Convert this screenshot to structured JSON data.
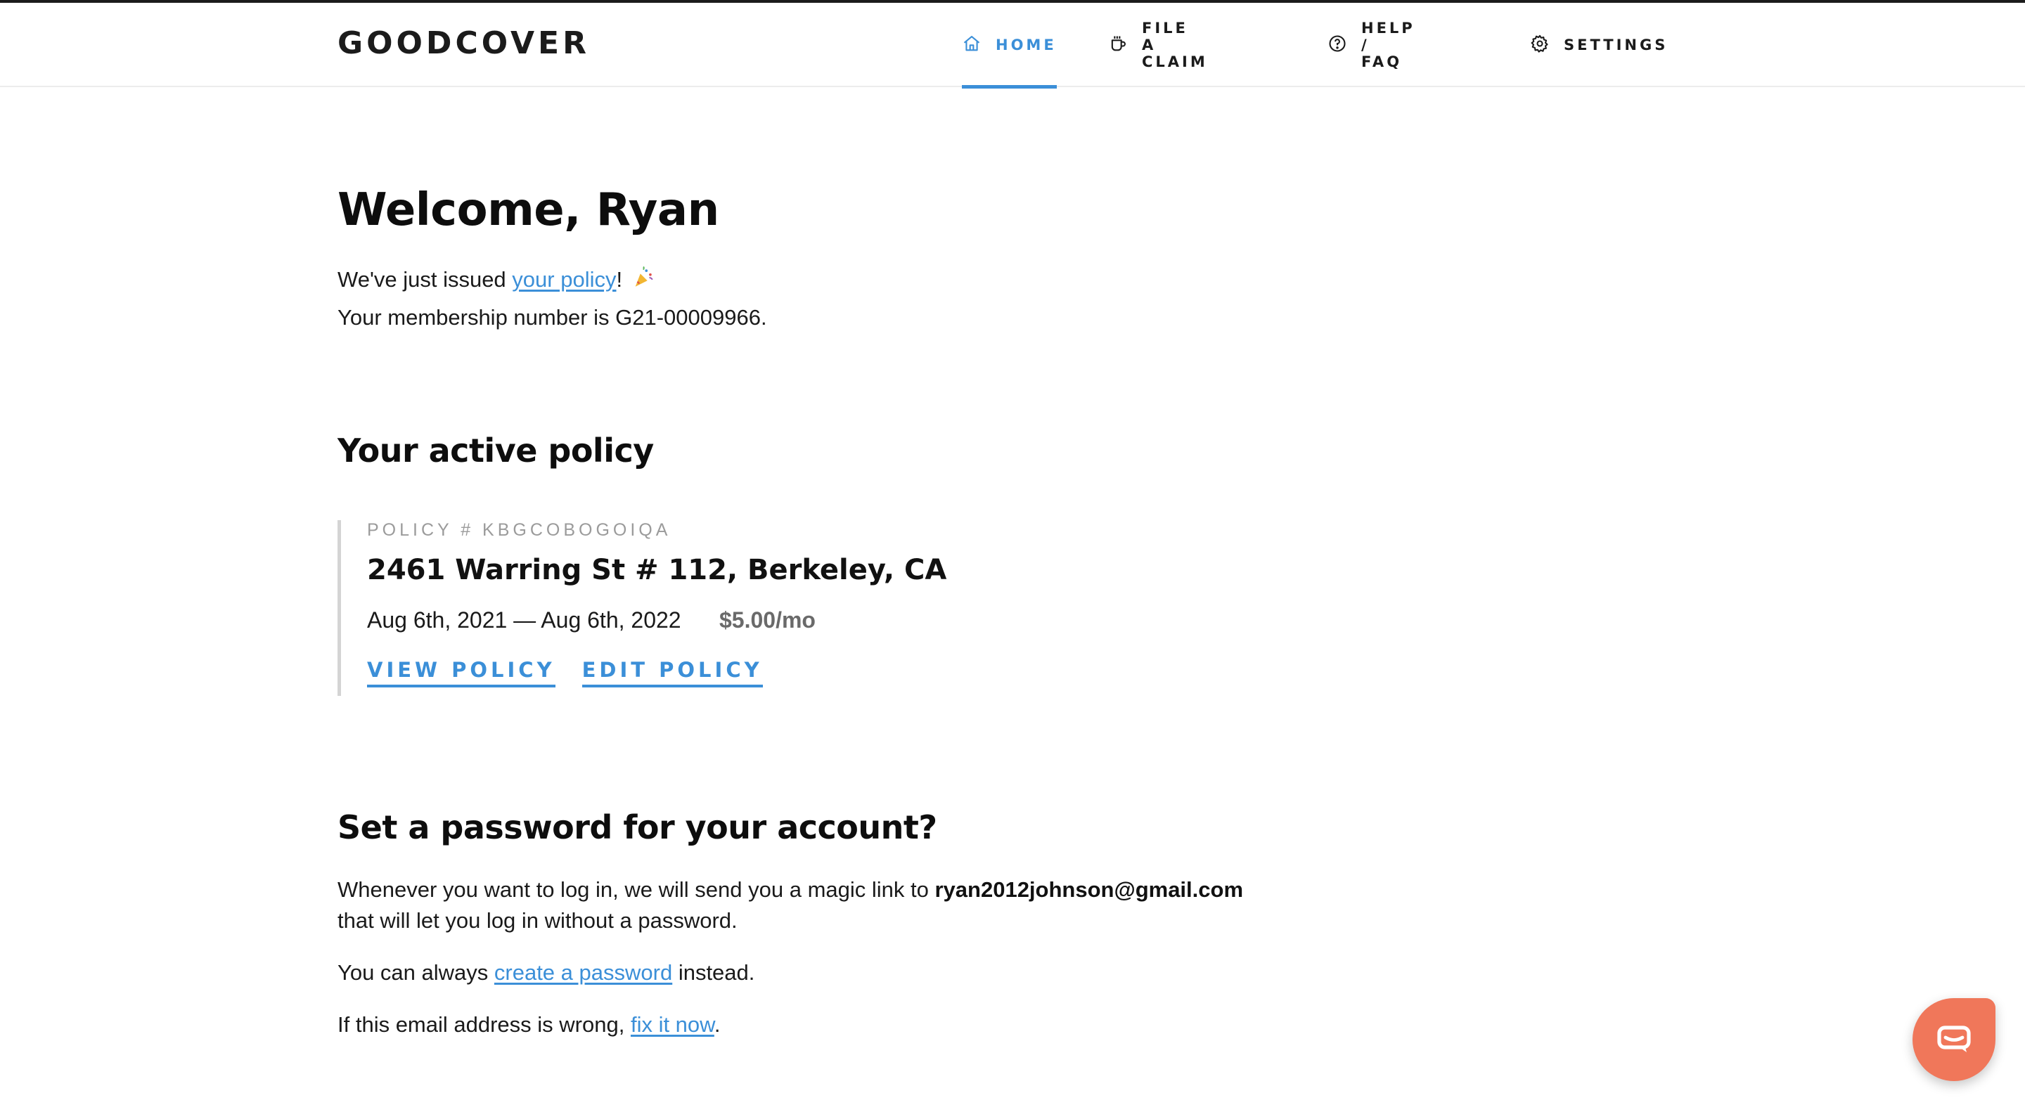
{
  "app": {
    "logo": "GOODCOVER"
  },
  "nav": {
    "items": [
      {
        "label": "HOME",
        "icon": "home-icon",
        "active": true
      },
      {
        "label": "FILE A CLAIM",
        "icon": "cup-icon",
        "active": false
      },
      {
        "label": "HELP / FAQ",
        "icon": "question-circle-icon",
        "active": false
      },
      {
        "label": "SETTINGS",
        "icon": "gear-icon",
        "active": false
      }
    ]
  },
  "welcome": {
    "title": "Welcome, Ryan",
    "issued_prefix": "We've just issued ",
    "issued_link": "your policy",
    "issued_suffix": "!",
    "issued_emoji_icon": "party-popper-icon",
    "membership_text": "Your membership number is G21-00009966."
  },
  "active_policy": {
    "heading": "Your active policy",
    "policy_number": "POLICY # KBGCOBOGOIQA",
    "address": "2461 Warring St # 112, Berkeley, CA",
    "dates": "Aug 6th, 2021 — Aug 6th, 2022",
    "price": "$5.00/mo",
    "view_label": "VIEW POLICY",
    "edit_label": "EDIT POLICY"
  },
  "password": {
    "heading": "Set a password for your account?",
    "line1_prefix": "Whenever you want to log in, we will send you a magic link to ",
    "email": "ryan2012johnson@gmail.com",
    "line2": "that will let you log in without a password.",
    "create_prefix": "You can always ",
    "create_link": "create a password",
    "create_suffix": " instead.",
    "fix_prefix": "If this email address is wrong, ",
    "fix_link": "fix it now",
    "fix_suffix": "."
  },
  "chat": {
    "icon": "chat-icon"
  },
  "colors": {
    "accent": "#3b8fd8",
    "chat": "#f0775a",
    "text": "#111111",
    "muted": "#9b9b9b"
  }
}
